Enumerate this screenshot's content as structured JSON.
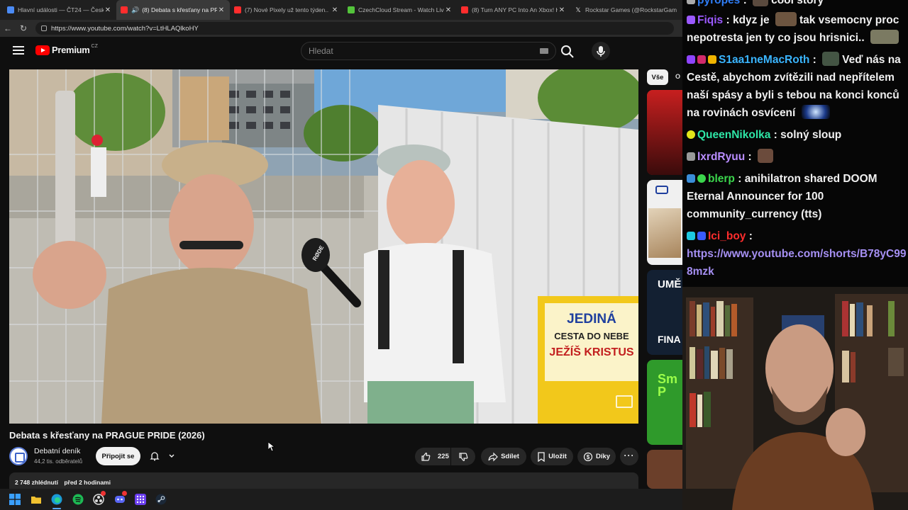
{
  "browser": {
    "tabs": [
      {
        "title": "Hlavní události — ČT24 — Česká ...",
        "color": "#4b8bf5",
        "active": false
      },
      {
        "title": "(8) Debata s křesťany na PRAGUE PRIDE (2026)",
        "color": "#ff2d2d",
        "active": true
      },
      {
        "title": "(7) Nové Pixely už tento týden.. | R...",
        "color": "#ff2d2d",
        "active": false
      },
      {
        "title": "CzechCloud Stream - Watch Live o...",
        "color": "#53c43b",
        "active": false
      },
      {
        "title": "(8) Turn ANY PC Into An Xbox! Hi...",
        "color": "#ff2d2d",
        "active": false
      },
      {
        "title": "Rockstar Games (@RockstarGame...",
        "color": "#e7e7e7",
        "active": false
      }
    ],
    "url": "https://www.youtube.com/watch?v=LtHLAQlkoHY"
  },
  "youtube": {
    "logo_text": "Premium",
    "country": "CZ",
    "search_placeholder": "Hledat",
    "video": {
      "title": "Debata s křesťany na PRAGUE PRIDE (2026)",
      "sign_text": [
        "JEDINÁ",
        "CESTA DO NEBE",
        "JEŽÍŠ KRISTUS"
      ],
      "mic_brand": "RØDE"
    },
    "channel": {
      "name": "Debatní deník",
      "subscribers": "44,2 tis. odběratelů",
      "join_label": "Připojit se"
    },
    "actions": {
      "like_count": "225",
      "share_label": "Sdílet",
      "save_label": "Uložit",
      "thanks_label": "Díky"
    },
    "description": {
      "views": "2 748 zhlédnutí",
      "time": "před 2 hodinami"
    },
    "related": {
      "chip_all": "Vše",
      "chip_next": "O",
      "thumb_labels": [
        "UMĚ",
        "FINA",
        "Sm P"
      ]
    }
  },
  "chat": {
    "messages": [
      {
        "user": "pyropes",
        "user_color": "#2f7df6",
        "text": "cool story"
      },
      {
        "user": "Fiqis",
        "user_color": "#9b59ff",
        "text_before": "kdyz je",
        "text": "tak vsemocny proc nepotresta jen ty co jsou hrisnici.."
      },
      {
        "user": "S1aa1neMacRoth",
        "user_color": "#3ab5ff",
        "text": "Veď nás na Cestě, abychom zvítězili nad nepřítelem naší spásy a byli s tebou na konci konců na rovinách osvícení"
      },
      {
        "user": "QueenNikolka",
        "user_color": "#2ee6a6",
        "text": "solný sloup"
      },
      {
        "user": "lxrdRyuu",
        "user_color": "#b98dff",
        "text": ""
      },
      {
        "user": "blerp",
        "user_color": "#3bd64d",
        "text": "anihilatron shared DOOM Eternal Announcer for 100 community_currency (tts)"
      },
      {
        "user": "Ici_boy",
        "user_color": "#ff2d2d",
        "text": "",
        "link": "https://www.youtube.com/shorts/B78yC998mzk"
      }
    ]
  }
}
